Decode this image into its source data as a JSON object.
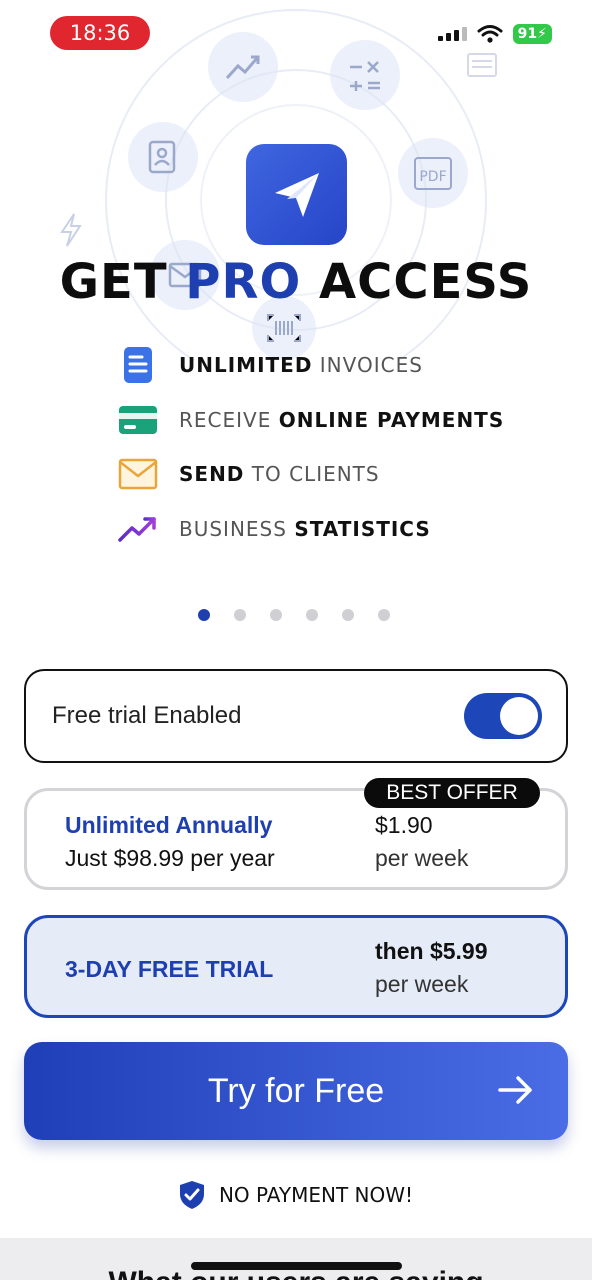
{
  "status_bar": {
    "time": "18:36",
    "battery": "91"
  },
  "headline": {
    "part1": "GET ",
    "accent": "PRO",
    "part2": " ACCESS"
  },
  "background_icons": {
    "pdf": "PDF"
  },
  "features": [
    {
      "icon": "document-icon",
      "bold": "UNLIMITED",
      "rest": " INVOICES"
    },
    {
      "icon": "credit-card-icon",
      "pre": "RECEIVE ",
      "bold": "ONLINE PAYMENTS"
    },
    {
      "icon": "envelope-icon",
      "bold": "SEND",
      "rest": " TO CLIENTS"
    },
    {
      "icon": "trending-up-icon",
      "pre": "BUSINESS ",
      "bold": "STATISTICS"
    }
  ],
  "pager": {
    "count": 6,
    "active_index": 0
  },
  "free_trial": {
    "label": "Free trial Enabled",
    "enabled": true
  },
  "plans": {
    "annual": {
      "badge": "BEST OFFER",
      "title": "Unlimited Annually",
      "subtitle": "Just $98.99 per year",
      "price": "$1.90",
      "unit": "per week"
    },
    "trial": {
      "title": "3-DAY FREE TRIAL",
      "price": "then $5.99",
      "unit": "per week"
    }
  },
  "cta": {
    "label": "Try for Free"
  },
  "no_payment": "NO PAYMENT NOW!",
  "reviews_heading": "What our users are saying",
  "colors": {
    "primary": "#1d3fb0",
    "accent_gradient_end": "#4a6de6",
    "status_time_bg": "#e0262f",
    "battery": "#32c84a"
  }
}
